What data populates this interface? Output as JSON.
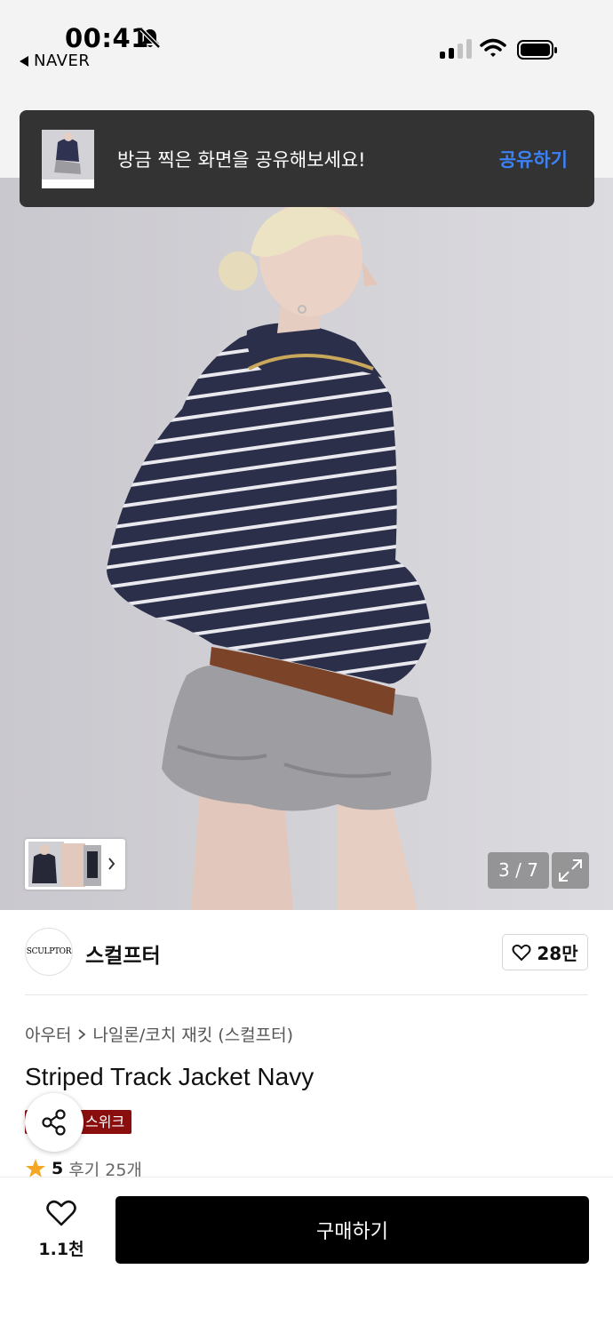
{
  "status": {
    "time": "00:41",
    "back_app": "NAVER"
  },
  "toast": {
    "message": "방금 찍은 화면을 공유해보세요!",
    "action": "공유하기"
  },
  "gallery": {
    "counter": "3 / 7",
    "current_index": 3,
    "total": 7
  },
  "brand": {
    "logo_text": "SCULPTOR",
    "name": "스컬프터",
    "likes": "28만"
  },
  "product": {
    "breadcrumb": [
      "아우터",
      "나일론/코치 재킷 (스컬프터)"
    ],
    "title": "Striped Track Jacket Navy",
    "badge": "스위크",
    "rating": "5",
    "reviews": "후기 25개"
  },
  "bottom": {
    "wish_count": "1.1천",
    "buy_label": "구매하기"
  },
  "colors": {
    "toast_bg": "#333333",
    "toast_action": "#3b82f6",
    "badge_bg": "#8b0e0e",
    "buy_bg": "#000000",
    "star": "#f5a623"
  },
  "icons": [
    "bell-slash-icon",
    "back-arrow-icon",
    "signal-icon",
    "wifi-icon",
    "battery-icon",
    "chevron-right-icon",
    "expand-icon",
    "heart-icon",
    "share-icon",
    "star-icon"
  ]
}
